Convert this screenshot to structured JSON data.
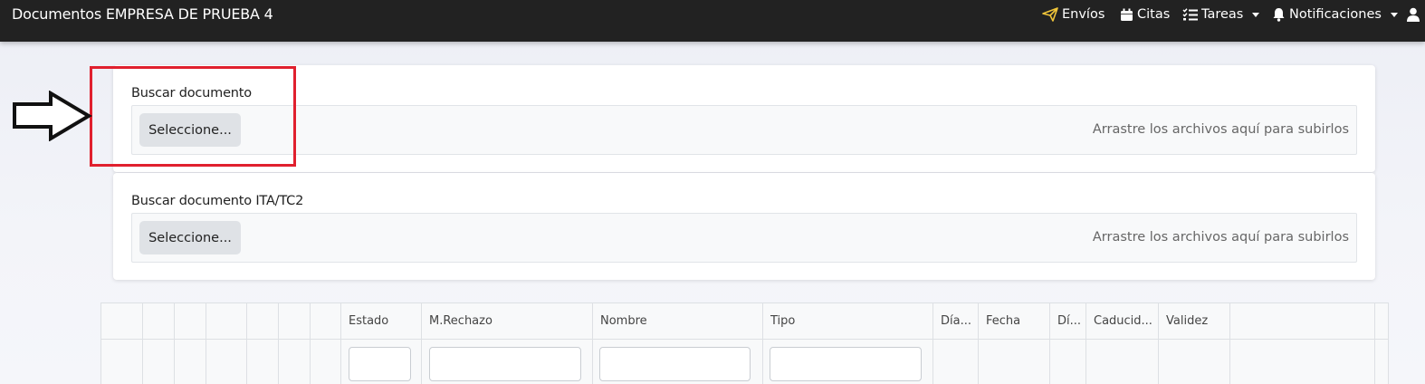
{
  "navbar": {
    "title": "Documentos EMPRESA DE PRUEBA 4",
    "items": [
      {
        "label": "Envíos",
        "icon": "paper-plane-icon",
        "color": "#f0c53a"
      },
      {
        "label": "Citas",
        "icon": "calendar-icon"
      },
      {
        "label": "Tareas",
        "icon": "task-list-icon",
        "dropdown": true
      },
      {
        "label": "Notificaciones",
        "icon": "bell-icon",
        "dropdown": true
      },
      {
        "label": "",
        "icon": "user-icon"
      }
    ]
  },
  "upload_cards": [
    {
      "label": "Buscar documento",
      "button": "Seleccione...",
      "hint": "Arrastre los archivos aquí para subirlos"
    },
    {
      "label": "Buscar documento ITA/TC2",
      "button": "Seleccione...",
      "hint": "Arrastre los archivos aquí para subirlos"
    }
  ],
  "annotation": {
    "highlight_color": "#e0202e"
  },
  "grid": {
    "columns": [
      "",
      "",
      "",
      "",
      "",
      "",
      "",
      "Estado",
      "M.Rechazo",
      "Nombre",
      "Tipo",
      "Día...",
      "Fecha",
      "Dí...",
      "Caducid...",
      "Validez",
      ""
    ]
  }
}
